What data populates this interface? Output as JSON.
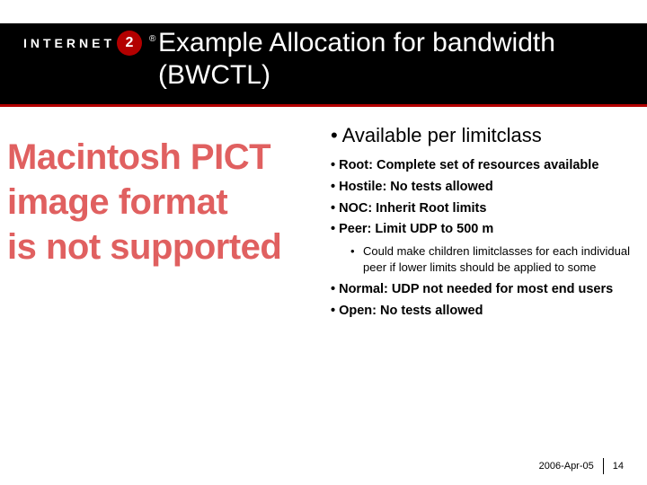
{
  "logo": {
    "left": "INTERNET",
    "badge": "2",
    "reg": "®"
  },
  "title": "Example Allocation for bandwidth (BWCTL)",
  "pict_placeholder": {
    "line1": "Macintosh PICT",
    "line2": "image format",
    "line3": "is not supported"
  },
  "content": {
    "lead": "• Available per limitclass",
    "items": [
      "• Root: Complete set of resources available",
      "• Hostile: No tests allowed",
      "• NOC: Inherit Root limits",
      "• Peer: Limit UDP to 500 m"
    ],
    "peer_sub": "Could make children limitclasses for each individual peer if lower limits should be applied to some",
    "items_after": [
      "• Normal: UDP not needed for most end users",
      "• Open: No tests allowed"
    ]
  },
  "footer": {
    "date": "2006-Apr-05",
    "page": "14"
  }
}
